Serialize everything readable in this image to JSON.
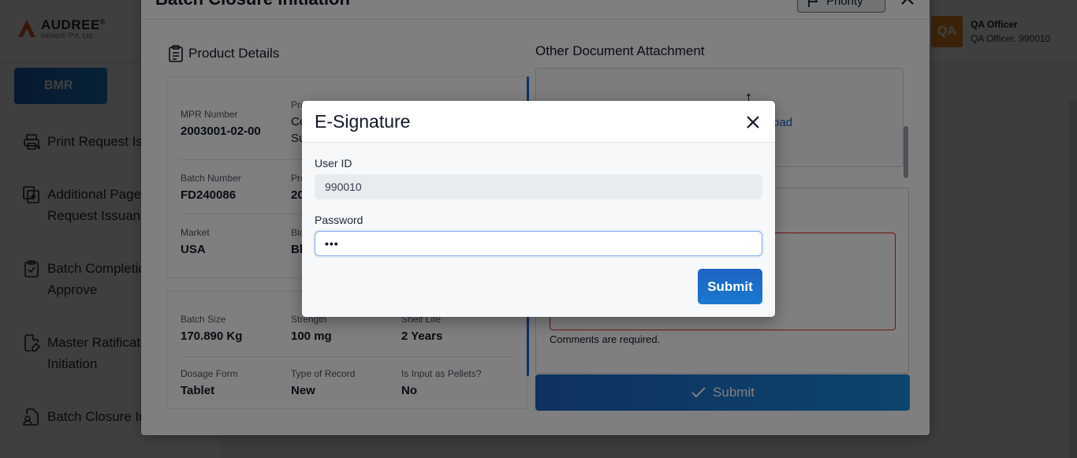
{
  "header": {
    "brand": "AUDREE",
    "brand_mark": "®",
    "brand_sub": "Infotech Pvt. Ltd.",
    "user_initials": "QA",
    "user_name": "QA Officer",
    "user_role": "QA Officer. 990010"
  },
  "sidebar": {
    "active_tab": "BMR",
    "items": [
      {
        "line1": "Print Request Iss",
        "line2": "",
        "icon": "print-icon"
      },
      {
        "line1": "Additional Page",
        "line2": "Request Issuanc",
        "icon": "add-page-icon"
      },
      {
        "line1": "Batch Completio",
        "line2": "Approve",
        "icon": "clipboard-check-icon"
      },
      {
        "line1": "Master Ratificati",
        "line2": "Initiation",
        "icon": "document-edit-icon"
      },
      {
        "line1": "Batch Closure In",
        "line2": "",
        "icon": "document-user-icon"
      }
    ]
  },
  "modal": {
    "title": "Batch Closure Initiation",
    "priority_label": "Priority",
    "product_details_title": "Product Details",
    "fields_top": [
      {
        "label": "MPR Number",
        "value": "2003001-02-00"
      },
      {
        "label": "Pro",
        "value": "Co"
      },
      {
        "label": "Batch Number",
        "value": "FD240086"
      },
      {
        "label": "Pro",
        "value": "20"
      },
      {
        "label": "Market",
        "value": "USA"
      },
      {
        "label": "Blo",
        "value": "Bl"
      }
    ],
    "value_extra": "Su",
    "fields_bottom": [
      {
        "label": "Batch Size",
        "value": "170.890 Kg"
      },
      {
        "label": "Strength",
        "value": "100 mg"
      },
      {
        "label": "Shelf Life",
        "value": "2 Years"
      },
      {
        "label": "Dosage Form",
        "value": "Tablet"
      },
      {
        "label": "Type of Record",
        "value": "New"
      },
      {
        "label": "Is Input as Pellets?",
        "value": "No"
      }
    ],
    "attachment_title": "Other Document Attachment",
    "upload_text": "oad",
    "comments_error": "Comments are required.",
    "submit_label": "Submit"
  },
  "esignature": {
    "title": "E-Signature",
    "user_id_label": "User ID",
    "user_id_value": "990010",
    "password_label": "Password",
    "password_value": "•••",
    "submit_label": "Submit"
  }
}
